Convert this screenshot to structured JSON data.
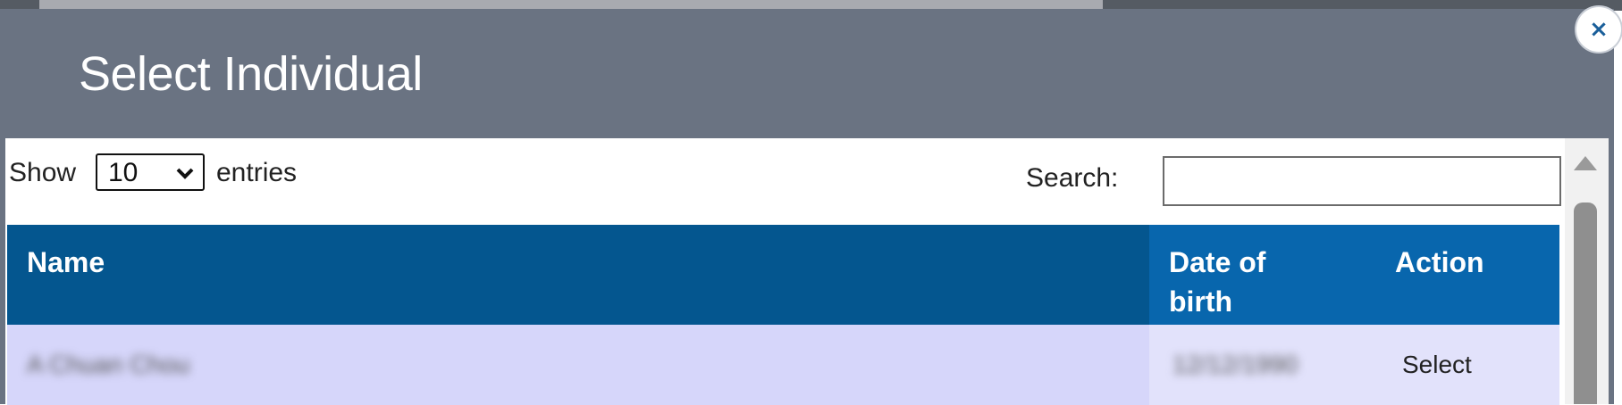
{
  "modal": {
    "title": "Select Individual",
    "close_label": "×"
  },
  "controls": {
    "show_label": "Show",
    "page_length": "10",
    "entries_label": "entries",
    "search_label": "Search:",
    "search_value": ""
  },
  "table": {
    "columns": [
      "Name",
      "Date of birth",
      "Action"
    ],
    "rows": [
      {
        "name": "A Chuan Chou",
        "dob": "12/12/1990",
        "action": "Select"
      }
    ]
  },
  "icons": {
    "close": "close-icon",
    "select_chevron": "chevron-down-icon",
    "scroll_up": "scroll-up-arrow-icon"
  }
}
